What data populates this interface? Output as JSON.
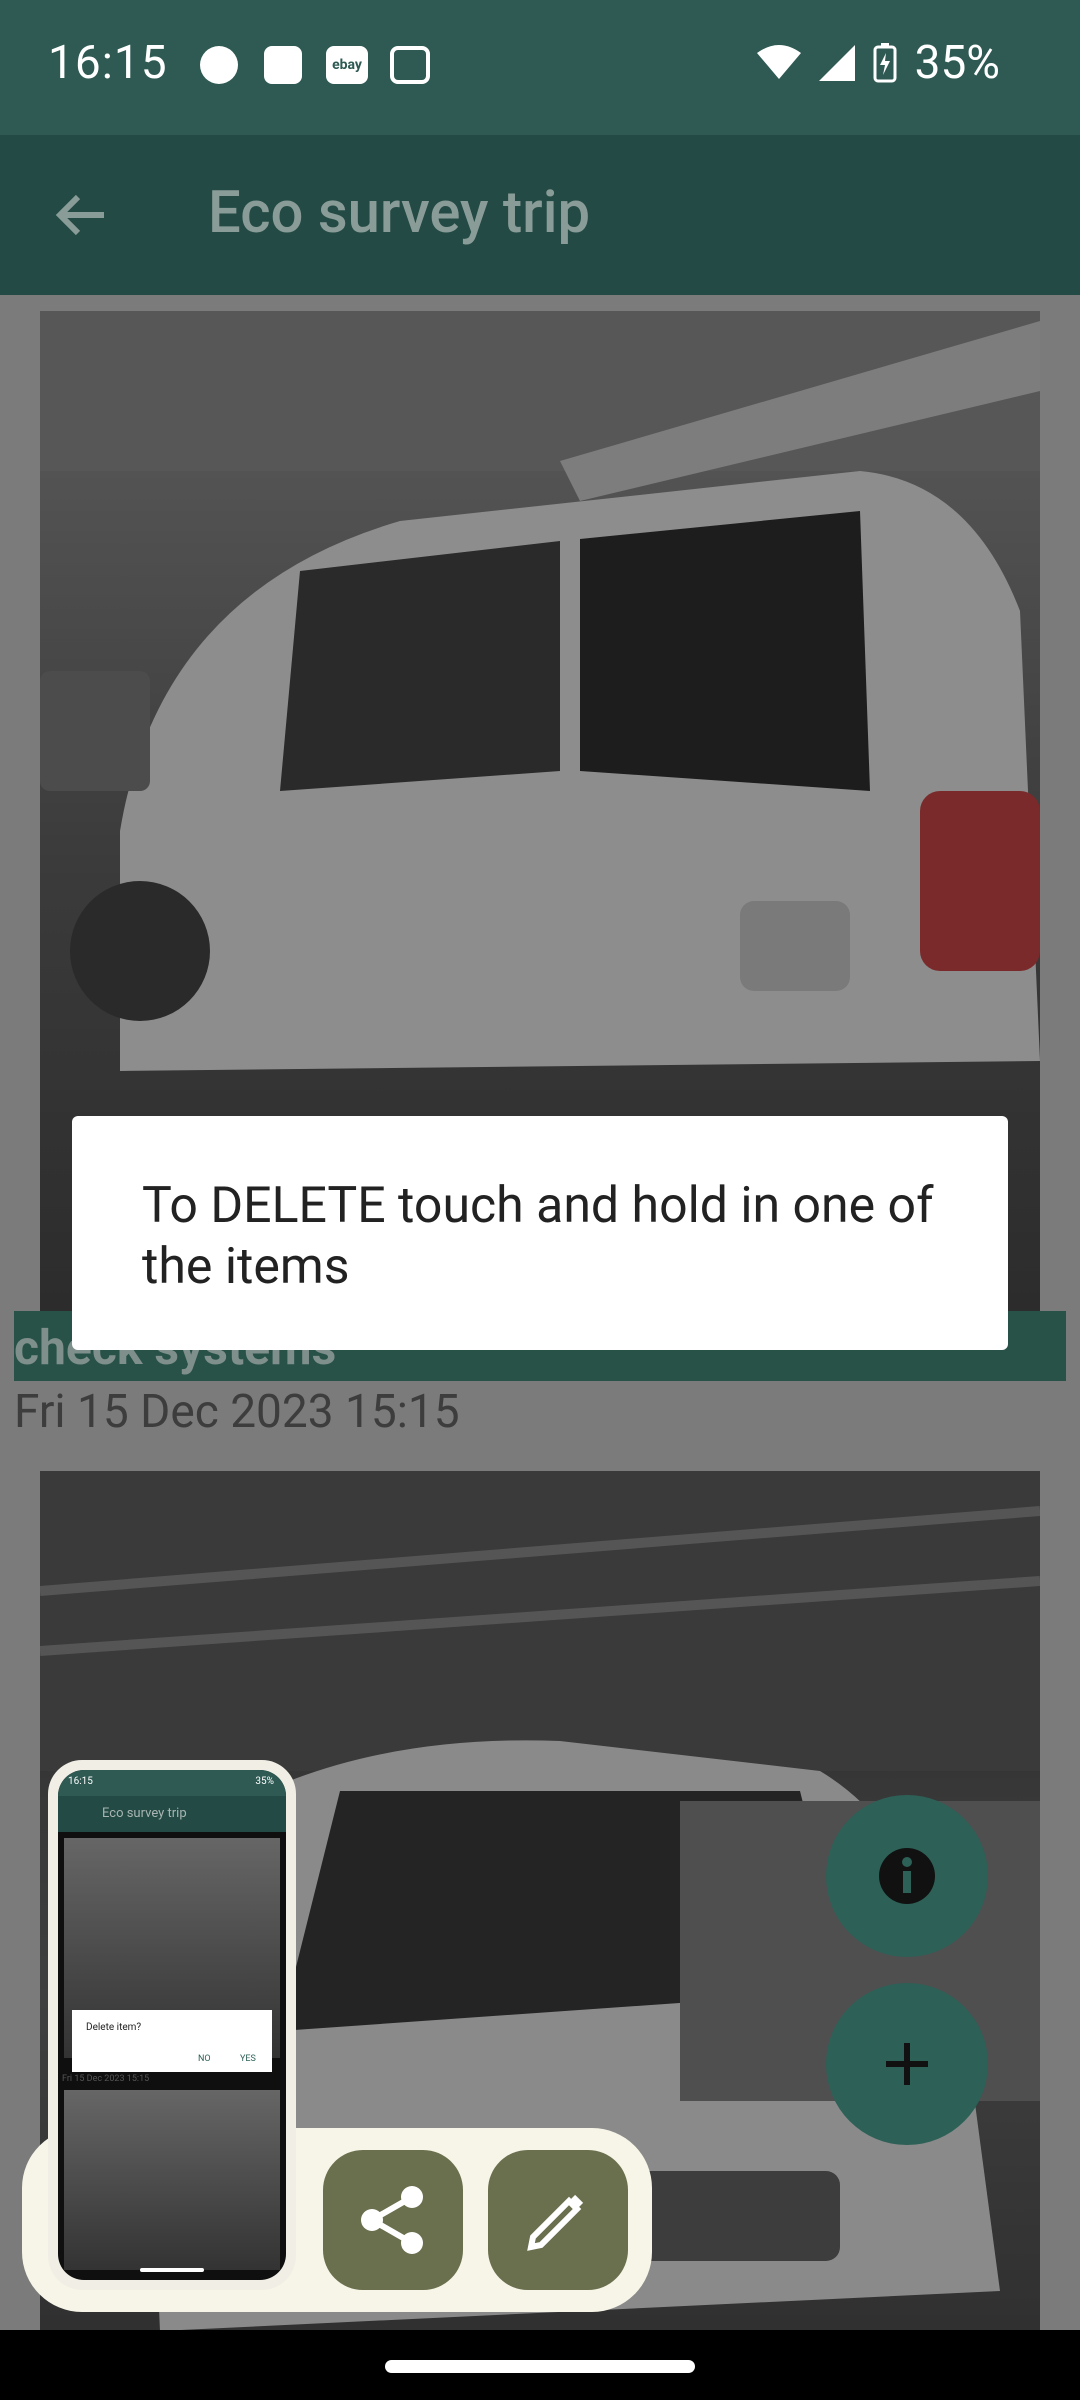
{
  "status_bar": {
    "time": "16:15",
    "battery": "35%",
    "notification_icons": [
      "cat-app-icon",
      "lamp-app-icon",
      "ebay-icon",
      "outlook-icon"
    ],
    "ebay_text": "ebay"
  },
  "app_bar": {
    "title": "Eco survey trip",
    "back_icon": "arrow-left-icon"
  },
  "items": [
    {
      "label": "check systems",
      "date": "Fri 15 Dec 2023 15:15"
    }
  ],
  "dialog": {
    "message": "To DELETE touch and hold in one of the items"
  },
  "fabs": {
    "info_icon": "info-icon",
    "add_icon": "plus-icon"
  },
  "screenshot_tray": {
    "share_icon": "share-icon",
    "edit_icon": "pencil-icon",
    "thumbnail": {
      "status_time": "16:15",
      "status_battery": "35%",
      "app_title": "Eco survey trip",
      "dialog_text": "Delete item?",
      "no_label": "NO",
      "yes_label": "YES",
      "date_text": "Fri 15 Dec 2023 15:15"
    }
  },
  "colors": {
    "status_bar": "#2e5a53",
    "app_bar": "#234a44",
    "fab": "#2d6056",
    "tray": "#f7f5e7",
    "tray_button": "#6a6f4e"
  }
}
